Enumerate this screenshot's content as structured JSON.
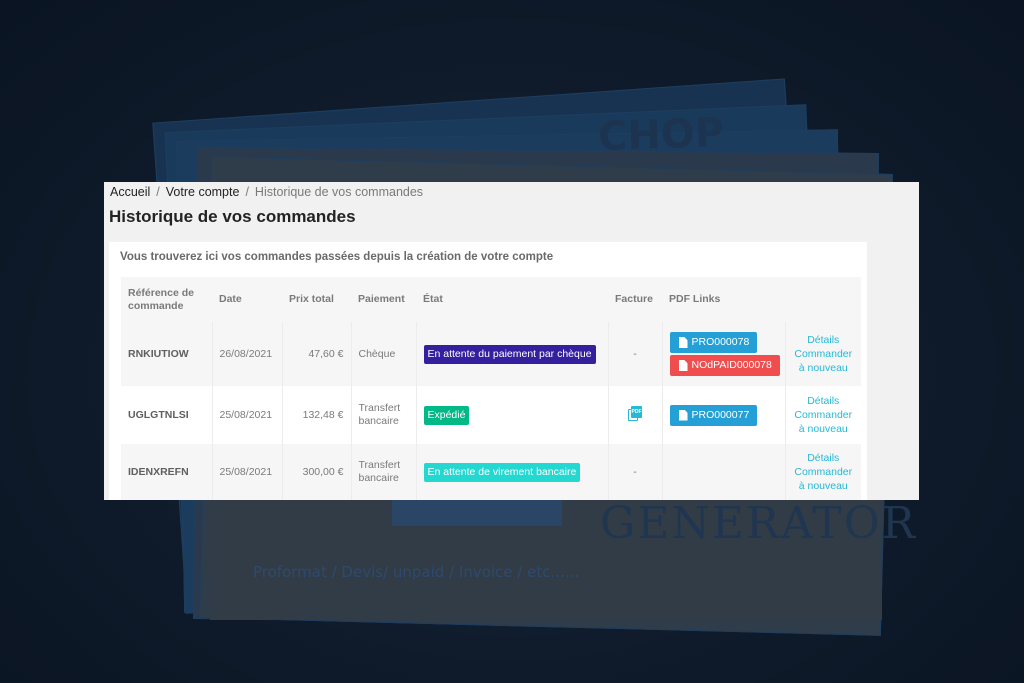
{
  "background": {
    "generator_text": "GENERATOR",
    "proforma_text": "Proformat / Devis/ unpaid / Invoice / etc......",
    "partial_text": "CHOP"
  },
  "breadcrumb": {
    "home": "Accueil",
    "account": "Votre compte",
    "current": "Historique de vos commandes"
  },
  "page_title": "Historique de vos commandes",
  "intro": "Vous trouverez ici vos commandes passées depuis la création de votre compte",
  "table": {
    "headers": {
      "reference": "Référence de commande",
      "date": "Date",
      "total": "Prix total",
      "payment": "Paiement",
      "status": "État",
      "invoice": "Facture",
      "pdf_links": "PDF Links"
    },
    "rows": [
      {
        "reference": "RNKIUTIOW",
        "date": "26/08/2021",
        "total": "47,60 €",
        "payment": "Chèque",
        "status": "En attente du paiement par chèque",
        "status_color": "#34209e",
        "invoice": "-",
        "pdf_links": [
          {
            "label": "PRO000078",
            "color": "#25a0d7"
          },
          {
            "label": "NOdPAID000078",
            "color": "#f04e4e"
          }
        ],
        "actions": {
          "details": "Détails",
          "reorder": "Commander à nouveau"
        }
      },
      {
        "reference": "UGLGTNLSI",
        "date": "25/08/2021",
        "total": "132,48 €",
        "payment": "Transfert bancaire",
        "status": "Expédié",
        "status_color": "#01b887",
        "invoice_icon": "pdf-document-icon",
        "pdf_links": [
          {
            "label": "PRO000077",
            "color": "#25a0d7"
          }
        ],
        "actions": {
          "details": "Détails",
          "reorder": "Commander à nouveau"
        }
      },
      {
        "reference": "IDENXREFN",
        "date": "25/08/2021",
        "total": "300,00 €",
        "payment": "Transfert bancaire",
        "status": "En attente de virement bancaire",
        "status_color": "#25d7d1",
        "invoice": "-",
        "pdf_links": [],
        "actions": {
          "details": "Détails",
          "reorder": "Commander à nouveau"
        }
      }
    ]
  },
  "colors": {
    "link": "#25b9d7",
    "panel_bg": "#f1f1f1"
  }
}
